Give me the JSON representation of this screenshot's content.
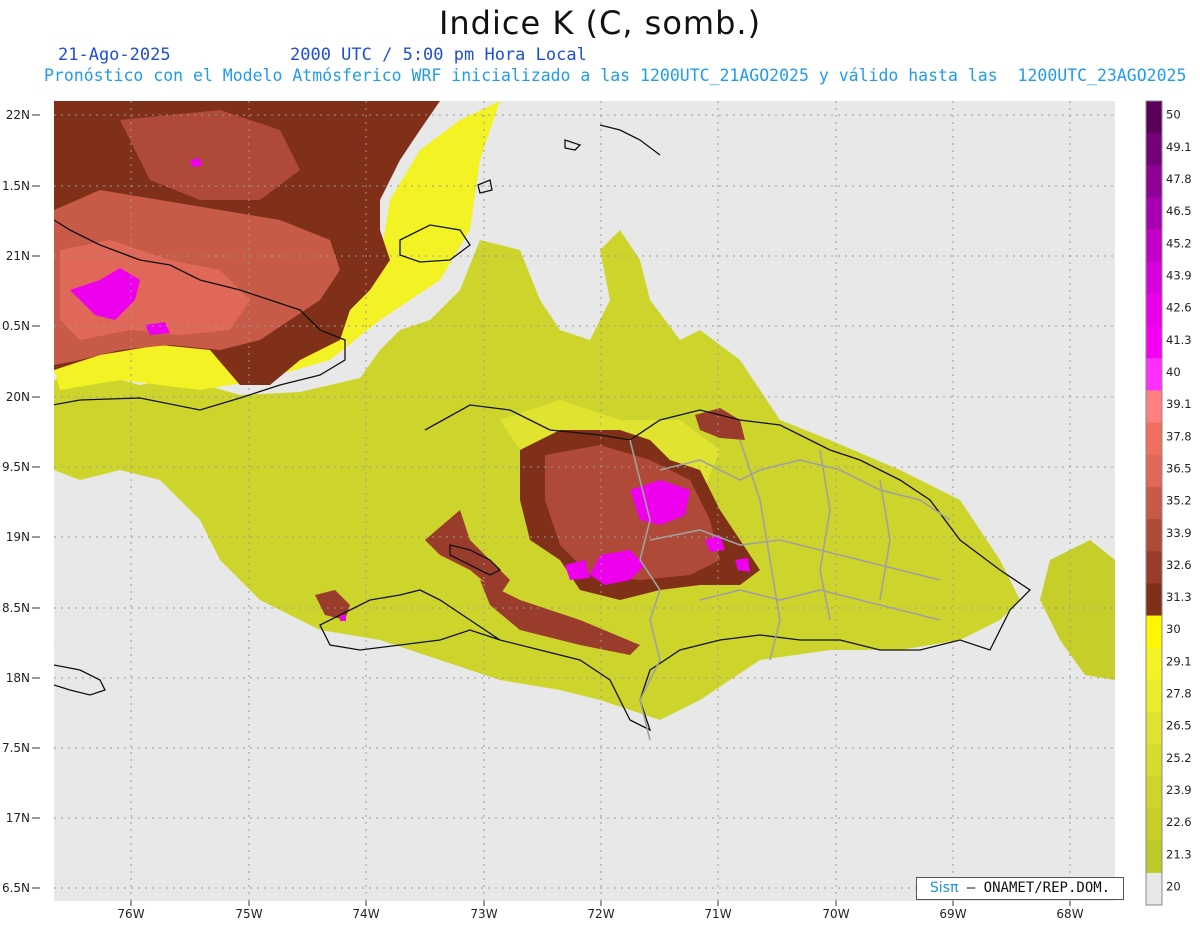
{
  "header": {
    "title": "Indice K (C, somb.)",
    "date": "21-Ago-2025",
    "time": "2000 UTC / 5:00 pm Hora Local",
    "forecast_note": "Pronóstico con el Modelo Atmósferico WRF inicializado a las 1200UTC_21AGO2025 y válido hasta las  1200UTC_23AGO2025"
  },
  "map": {
    "lat_labels": [
      "22N",
      "1.5N",
      "21N",
      "0.5N",
      "20N",
      "9.5N",
      "19N",
      "8.5N",
      "18N",
      "7.5N",
      "17N",
      "6.5N"
    ],
    "lon_labels": [
      "76W",
      "75W",
      "74W",
      "73W",
      "72W",
      "71W",
      "70W",
      "69W",
      "68W"
    ],
    "background_color": "#e8e8e8",
    "gridlines": "dotted"
  },
  "colorbar": {
    "labels": [
      "50",
      "49.1",
      "47.8",
      "46.5",
      "45.2",
      "43.9",
      "42.6",
      "41.3",
      "40",
      "39.1",
      "37.8",
      "36.5",
      "35.2",
      "33.9",
      "32.6",
      "31.3",
      "30",
      "29.1",
      "27.8",
      "26.5",
      "25.2",
      "23.9",
      "22.6",
      "21.3",
      "20"
    ],
    "colors": [
      "#5a005a",
      "#75007a",
      "#8f0096",
      "#a800b0",
      "#c200c8",
      "#d800dc",
      "#ea00ea",
      "#f500f5",
      "#ff30ff",
      "#ff8080",
      "#f07060",
      "#e06858",
      "#c85a48",
      "#b04a38",
      "#9a3c2c",
      "#803018",
      "#fff700",
      "#f2f225",
      "#e8ec2a",
      "#e0e430",
      "#d6dc2e",
      "#cdd52c",
      "#c6cf2a",
      "#bec828",
      "#e8e8e8"
    ]
  },
  "logo": {
    "brand": "Sisπ",
    "text": "– ONAMET/REP.DOM."
  }
}
